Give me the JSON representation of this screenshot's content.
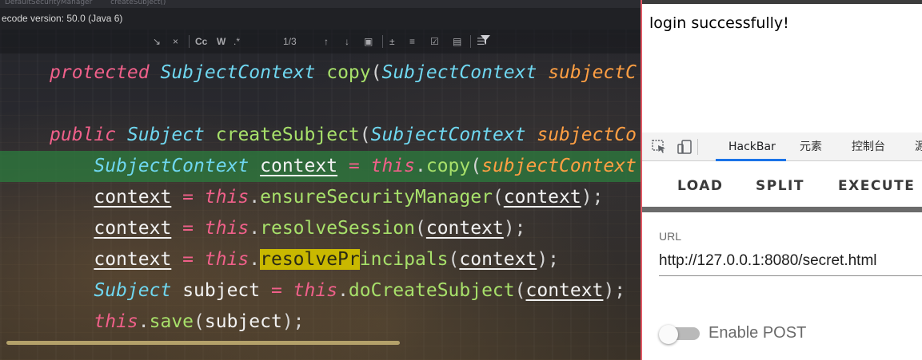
{
  "ide": {
    "breadcrumb": [
      "DefaultSecurityManager",
      "createSubject()"
    ],
    "bytecode_version": "ecode version: 50.0 (Java 6)",
    "find_toolbar": {
      "match_case": "Cc",
      "words": "W",
      "match_count": "1/3"
    },
    "code_lines": [
      [
        {
          "t": "protected",
          "c": "kw"
        },
        {
          "t": " ",
          "c": "pn"
        },
        {
          "t": "SubjectContext",
          "c": "ty"
        },
        {
          "t": " ",
          "c": "pn"
        },
        {
          "t": "copy",
          "c": "fn"
        },
        {
          "t": "(",
          "c": "pn"
        },
        {
          "t": "SubjectContext",
          "c": "ty"
        },
        {
          "t": " ",
          "c": "pn"
        },
        {
          "t": "subjectC",
          "c": "pm"
        }
      ],
      [],
      [
        {
          "t": "public",
          "c": "kw"
        },
        {
          "t": " ",
          "c": "pn"
        },
        {
          "t": "Subject",
          "c": "ty"
        },
        {
          "t": " ",
          "c": "pn"
        },
        {
          "t": "createSubject",
          "c": "fn"
        },
        {
          "t": "(",
          "c": "pn"
        },
        {
          "t": "SubjectContext",
          "c": "ty"
        },
        {
          "t": " ",
          "c": "pn"
        },
        {
          "t": "subjectCo",
          "c": "pm"
        }
      ],
      [
        {
          "t": "    ",
          "c": "pn"
        },
        {
          "t": "SubjectContext",
          "c": "ty"
        },
        {
          "t": " ",
          "c": "pn"
        },
        {
          "t": "context",
          "c": "var"
        },
        {
          "t": " = ",
          "c": "op"
        },
        {
          "t": "this",
          "c": "kw"
        },
        {
          "t": ".",
          "c": "pn"
        },
        {
          "t": "copy",
          "c": "fn"
        },
        {
          "t": "(",
          "c": "pn"
        },
        {
          "t": "subjectContext",
          "c": "pm"
        }
      ],
      [
        {
          "t": "    ",
          "c": "pn"
        },
        {
          "t": "context",
          "c": "var"
        },
        {
          "t": " = ",
          "c": "op"
        },
        {
          "t": "this",
          "c": "kw"
        },
        {
          "t": ".",
          "c": "pn"
        },
        {
          "t": "ensureSecurityManager",
          "c": "fn"
        },
        {
          "t": "(",
          "c": "pn"
        },
        {
          "t": "context",
          "c": "var"
        },
        {
          "t": ");",
          "c": "pn"
        }
      ],
      [
        {
          "t": "    ",
          "c": "pn"
        },
        {
          "t": "context",
          "c": "var"
        },
        {
          "t": " = ",
          "c": "op"
        },
        {
          "t": "this",
          "c": "kw"
        },
        {
          "t": ".",
          "c": "pn"
        },
        {
          "t": "resolveSession",
          "c": "fn"
        },
        {
          "t": "(",
          "c": "pn"
        },
        {
          "t": "context",
          "c": "var"
        },
        {
          "t": ");",
          "c": "pn"
        }
      ],
      [
        {
          "t": "    ",
          "c": "pn"
        },
        {
          "t": "context",
          "c": "var"
        },
        {
          "t": " = ",
          "c": "op"
        },
        {
          "t": "this",
          "c": "kw"
        },
        {
          "t": ".",
          "c": "pn"
        },
        {
          "t": "resolvePr",
          "c": "fn match"
        },
        {
          "t": "incipals",
          "c": "fn"
        },
        {
          "t": "(",
          "c": "pn"
        },
        {
          "t": "context",
          "c": "var"
        },
        {
          "t": ");",
          "c": "pn"
        }
      ],
      [
        {
          "t": "    ",
          "c": "pn"
        },
        {
          "t": "Subject",
          "c": "ty"
        },
        {
          "t": " ",
          "c": "pn"
        },
        {
          "t": "subject",
          "c": "plain"
        },
        {
          "t": " = ",
          "c": "op"
        },
        {
          "t": "this",
          "c": "kw"
        },
        {
          "t": ".",
          "c": "pn"
        },
        {
          "t": "doCreateSubject",
          "c": "fn"
        },
        {
          "t": "(",
          "c": "pn"
        },
        {
          "t": "context",
          "c": "var"
        },
        {
          "t": ");",
          "c": "pn"
        }
      ],
      [
        {
          "t": "    ",
          "c": "pn"
        },
        {
          "t": "this",
          "c": "kw"
        },
        {
          "t": ".",
          "c": "pn"
        },
        {
          "t": "save",
          "c": "fn"
        },
        {
          "t": "(",
          "c": "pn"
        },
        {
          "t": "subject",
          "c": "plain"
        },
        {
          "t": ");",
          "c": "pn"
        }
      ]
    ],
    "highlighted_line": 3
  },
  "browser": {
    "page_message": "login successfully!",
    "devtools": {
      "tabs": [
        "HackBar",
        "元素",
        "控制台",
        "源"
      ],
      "active_tab": "HackBar",
      "inspect_icon": "inspect-element-icon",
      "device_icon": "device-toolbar-icon"
    },
    "hackbar": {
      "buttons": {
        "load": "LOAD",
        "split": "SPLIT",
        "execute": "EXECUTE"
      },
      "url_label": "URL",
      "url_value": "http://127.0.0.1:8080/secret.html",
      "enable_post_label": "Enable POST",
      "enable_post": false
    }
  }
}
